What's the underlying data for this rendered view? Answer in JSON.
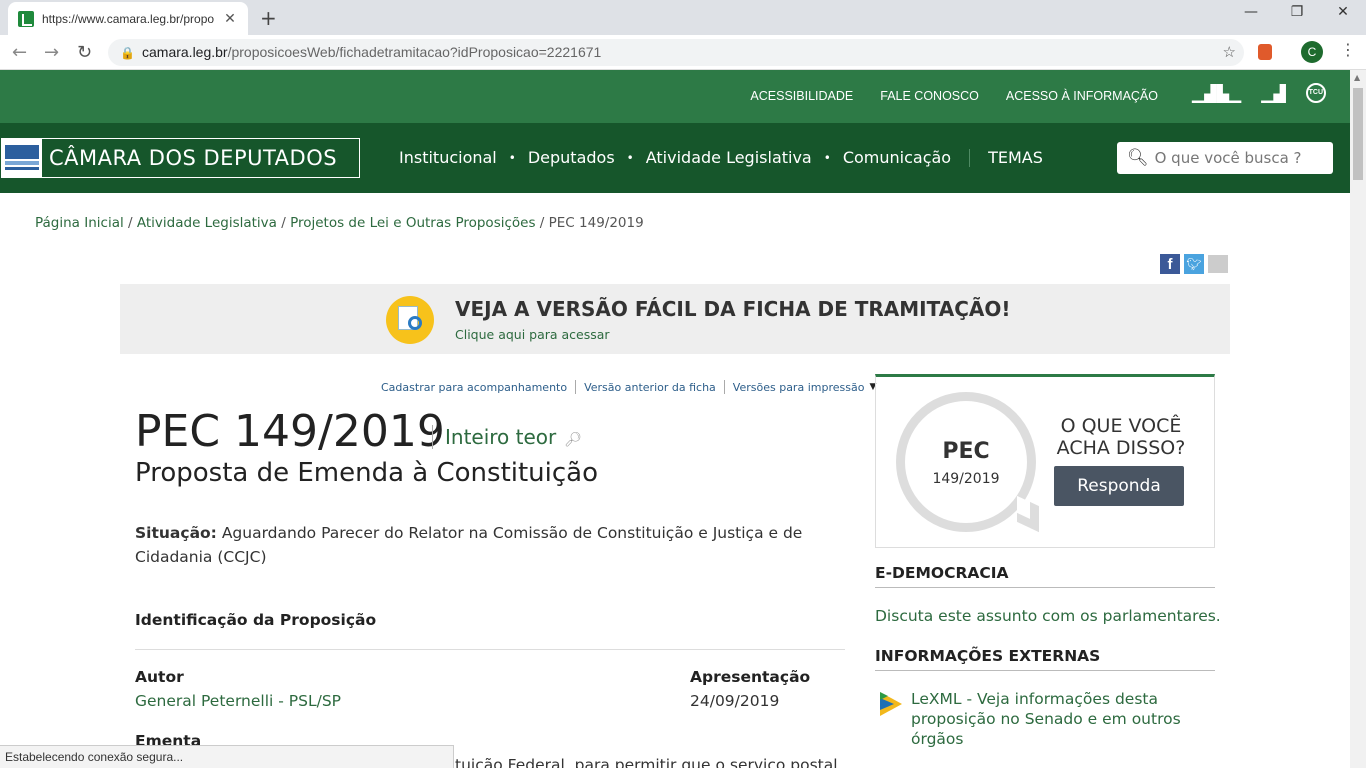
{
  "browser": {
    "tab_title": "https://www.camara.leg.br/propo",
    "tab_close": "✕",
    "new_tab": "+",
    "url_host": "camara.leg.br",
    "url_path": "/proposicoesWeb/fichadetramitacao?idProposicao=2221671",
    "profile_initial": "C",
    "status_text": "Estabelecendo conexão segura..."
  },
  "header": {
    "top_links": [
      "ACESSIBILIDADE",
      "FALE CONOSCO",
      "ACESSO À INFORMAÇÃO"
    ],
    "tcu_label": "TCU",
    "logo_text": "CÂMARA DOS DEPUTADOS",
    "menu": [
      "Institucional",
      "Deputados",
      "Atividade Legislativa",
      "Comunicação",
      "TEMAS"
    ],
    "search_placeholder": "O que você busca ?"
  },
  "breadcrumb": {
    "items": [
      "Página Inicial",
      "Atividade Legislativa",
      "Projetos de Lei e Outras Proposições"
    ],
    "current": "PEC 149/2019"
  },
  "banner": {
    "title": "VEJA A VERSÃO FÁCIL DA FICHA DE TRAMITAÇÃO!",
    "subtitle": "Clique aqui para acessar"
  },
  "actions": [
    "Cadastrar para acompanhamento",
    "Versão anterior da ficha",
    "Versões para impressão"
  ],
  "proposicao": {
    "title": "PEC 149/2019",
    "inteiro_teor": "Inteiro teor",
    "subtitle": "Proposta de Emenda à Constituição",
    "situacao_label": "Situação:",
    "situacao_text": "Aguardando Parecer do Relator na Comissão de Constituição e Justiça e de Cidadania (CCJC)",
    "ident_heading": "Identificação da Proposição",
    "autor_label": "Autor",
    "autor_value": "General Peternelli - PSL/SP",
    "apresentacao_label": "Apresentação",
    "apresentacao_value": "24/09/2019",
    "ementa_label": "Ementa",
    "ementa_value": "tuição Federal, para permitir que o serviço postal"
  },
  "sidebar": {
    "bubble_title": "PEC",
    "bubble_number": "149/2019",
    "question": "O QUE VOCÊ ACHA DISSO?",
    "respond_button": "Responda",
    "edemocracia_heading": "E-DEMOCRACIA",
    "edemocracia_text": "Discuta este assunto com os parlamentares.",
    "externas_heading": "INFORMAÇÕES EXTERNAS",
    "lexml_text": "LeXML - Veja informações desta proposição no Senado e em outros órgãos"
  }
}
